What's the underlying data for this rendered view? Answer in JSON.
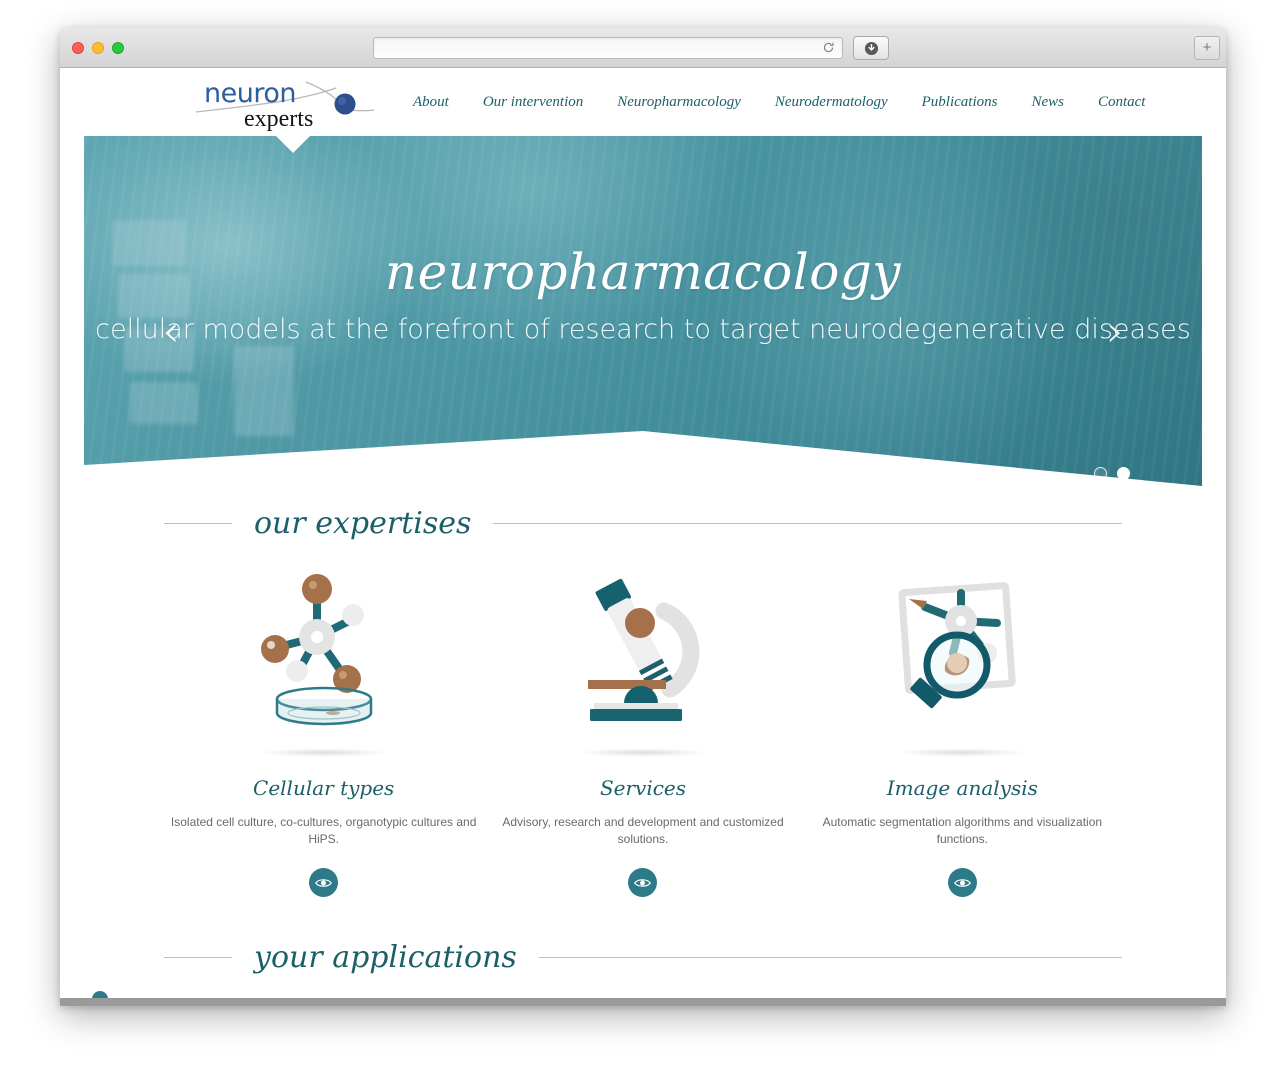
{
  "browser": {
    "traffic_lights": [
      "close",
      "minimize",
      "maximize"
    ],
    "address_value": "",
    "address_placeholder": "",
    "reload_icon": "reload-icon",
    "download_icon": "download-icon",
    "new_tab_label": "+"
  },
  "site": {
    "logo": {
      "primary_text": "neuron",
      "secondary_text": "experts",
      "primary_color": "#2d5f9e",
      "secondary_color": "#1a1a1a"
    },
    "nav": {
      "items": [
        {
          "label": "About"
        },
        {
          "label": "Our intervention"
        },
        {
          "label": "Neuropharmacology"
        },
        {
          "label": "Neurodermatology"
        },
        {
          "label": "Publications"
        },
        {
          "label": "News"
        },
        {
          "label": "Contact"
        }
      ]
    }
  },
  "hero": {
    "title": "neuropharmacology",
    "subtitle": "cellular models at the forefront of research to target neurodegenerative diseases",
    "prev_icon": "‹",
    "next_icon": "›",
    "dots": [
      {
        "active": false
      },
      {
        "active": true
      }
    ],
    "accent_color": "#3d8895"
  },
  "expertises": {
    "heading": "our expertises",
    "cards": [
      {
        "icon": "molecule-petri-dish-icon",
        "title": "Cellular types",
        "description": "Isolated cell culture, co-cultures, organotypic cultures and HiPS.",
        "action_icon": "eye-icon"
      },
      {
        "icon": "microscope-icon",
        "title": "Services",
        "description": "Advisory, research and development and customized solutions.",
        "action_icon": "eye-icon"
      },
      {
        "icon": "image-analysis-magnifier-icon",
        "title": "Image analysis",
        "description": "Automatic segmentation algorithms and visualization functions.",
        "action_icon": "eye-icon"
      }
    ]
  },
  "applications": {
    "heading": "your applications",
    "tiles": [
      {
        "name": "application-tile-teal",
        "color": "#2f7d8d"
      },
      {
        "name": "application-tile-tan",
        "color": "#cfa585"
      }
    ],
    "decoration": "neuron-network-decoration"
  },
  "theme": {
    "teal": "#1b5f68",
    "teal_mid": "#2d7b88",
    "rule": "#c9bfa8",
    "body_text": "#6a6a6a"
  }
}
